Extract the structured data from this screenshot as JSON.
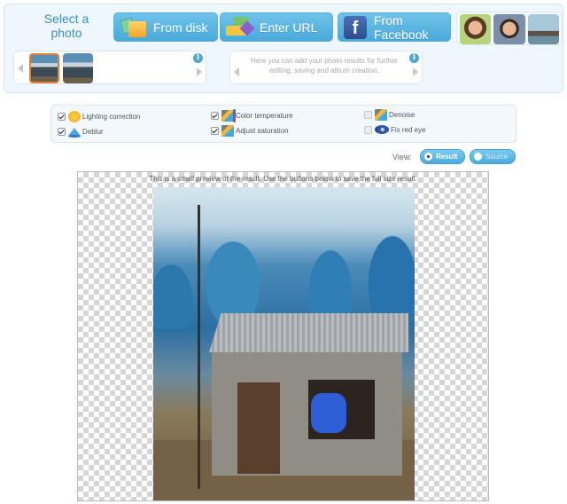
{
  "header": {
    "select_label": "Select a photo",
    "buttons": [
      {
        "label": "From disk",
        "icon": "folder-icon"
      },
      {
        "label": "Enter URL",
        "icon": "url-icon"
      },
      {
        "label": "From Facebook",
        "icon": "facebook-icon"
      }
    ],
    "samples": [
      "sample-woman",
      "sample-man",
      "sample-boat"
    ]
  },
  "tray_left": {
    "info_icon": "i",
    "thumbnails": 2,
    "selected_index": 0
  },
  "tray_right": {
    "text": "Here you can add your photo results for further editing, saving and album creation.",
    "info_icon": "i"
  },
  "options": [
    {
      "label": "Lighting correction",
      "checked": true,
      "icon": "sun-icon"
    },
    {
      "label": "Deblur",
      "checked": true,
      "icon": "deblur-icon"
    },
    {
      "label": "Color temperature",
      "checked": true,
      "icon": "temperature-icon"
    },
    {
      "label": "Adjust saturation",
      "checked": true,
      "icon": "saturation-icon"
    },
    {
      "label": "Denoise",
      "checked": false,
      "icon": "denoise-icon"
    },
    {
      "label": "Fix red eye",
      "checked": false,
      "icon": "eye-icon"
    }
  ],
  "view": {
    "label": "View:",
    "options": [
      {
        "label": "Result",
        "selected": true
      },
      {
        "label": "Source",
        "selected": false
      }
    ]
  },
  "preview": {
    "note": "This is a small preview of the result. Use the buttons below to save the full size result."
  },
  "colors": {
    "accent": "#4aa9da",
    "panel_bg": "#eef7fd",
    "select_text": "#3d8fc0",
    "selected_thumb_border": "#e38234"
  }
}
